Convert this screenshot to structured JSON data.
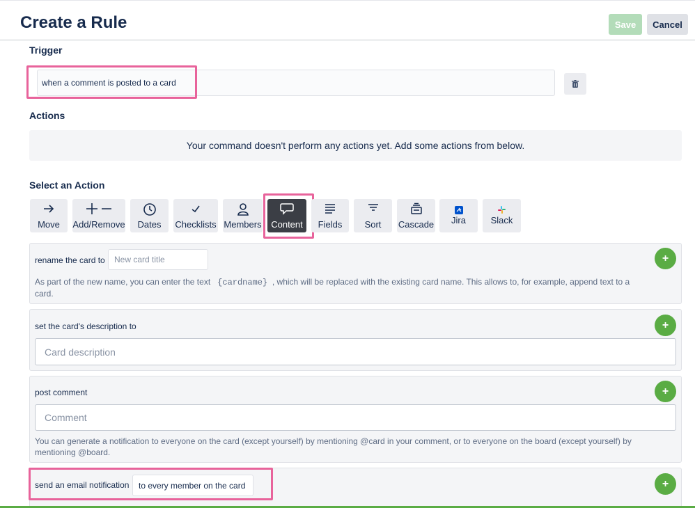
{
  "header": {
    "title": "Create a Rule",
    "save_label": "Save",
    "cancel_label": "Cancel"
  },
  "trigger": {
    "heading": "Trigger",
    "text": "when a comment is posted to a card"
  },
  "actions": {
    "heading": "Actions",
    "empty_text": "Your command doesn't perform any actions yet. Add some actions from below."
  },
  "select_action": {
    "heading": "Select an Action",
    "tabs": [
      {
        "label": "Move",
        "icon": "arrow-right-icon"
      },
      {
        "label": "Add/Remove",
        "icon": "plus-minus-icon"
      },
      {
        "label": "Dates",
        "icon": "clock-icon"
      },
      {
        "label": "Checklists",
        "icon": "checkmark-icon"
      },
      {
        "label": "Members",
        "icon": "person-icon"
      },
      {
        "label": "Content",
        "icon": "comment-icon",
        "active": true
      },
      {
        "label": "Fields",
        "icon": "lines-icon"
      },
      {
        "label": "Sort",
        "icon": "sort-icon"
      },
      {
        "label": "Cascade",
        "icon": "stack-icon"
      },
      {
        "label": "Jira",
        "icon": "jira-icon"
      },
      {
        "label": "Slack",
        "icon": "slack-icon"
      }
    ]
  },
  "rename": {
    "label": "rename the card to",
    "placeholder": "New card title",
    "help_pre": "As part of the new name, you can enter the text",
    "help_code": "{cardname}",
    "help_post": ", which will be replaced with the existing card name. This allows to, for example, append text to a card."
  },
  "description": {
    "label": "set the card's description to",
    "placeholder": "Card description"
  },
  "comment": {
    "label": "post comment",
    "placeholder": "Comment",
    "help": "You can generate a notification to everyone on the card (except yourself) by mentioning @card in your comment, or to everyone on the board (except yourself) by mentioning @board."
  },
  "email": {
    "label": "send an email notification",
    "value": "to every member on the card"
  },
  "add_symbol": "+",
  "colors": {
    "highlight": "#e8639b",
    "add_green": "#5aac44",
    "active_tab": "#3b3e45"
  }
}
